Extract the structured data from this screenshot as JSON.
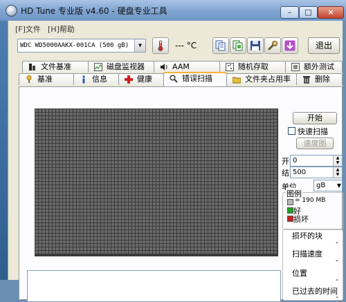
{
  "window": {
    "title": "HD Tune 专业版 v4.60 - 硬盘专业工具",
    "min_glyph": "–",
    "max_glyph": "□",
    "close_glyph": "×"
  },
  "menu": [
    {
      "label": "[F]文件"
    },
    {
      "label": "[H]帮助"
    }
  ],
  "toolbar": {
    "drive_value": "WDC    WD5000AAKX-001CA (500 gB)",
    "temperature": "--- °C",
    "exit_label": "退出"
  },
  "tabs_top": [
    {
      "label": "文件基准",
      "icon": "file-benchmark-icon"
    },
    {
      "label": "磁盘监视器",
      "icon": "disk-monitor-icon"
    },
    {
      "label": "AAM",
      "icon": "speaker-icon"
    },
    {
      "label": "随机存取",
      "icon": "random-access-icon"
    },
    {
      "label": "额外测试",
      "icon": "extra-tests-icon"
    }
  ],
  "tabs_bottom": [
    {
      "label": "基准",
      "icon": "benchmark-icon"
    },
    {
      "label": "信息",
      "icon": "info-icon"
    },
    {
      "label": "健康",
      "icon": "health-icon"
    },
    {
      "label": "错误扫描",
      "icon": "error-scan-icon",
      "active": true
    },
    {
      "label": "文件夹占用率",
      "icon": "folder-usage-icon"
    },
    {
      "label": "删除",
      "icon": "erase-icon"
    }
  ],
  "scan": {
    "start_button": "开始",
    "quick_scan_label": "快速扫描",
    "quick_scan_checked": false,
    "speed_map_button": "速度图",
    "start_label": "开始",
    "start_value": "0",
    "end_label": "结束",
    "end_value": "500",
    "unit_label": "单位",
    "unit_value": "gB"
  },
  "legend": {
    "title": "图例",
    "block_size": "= 190 MB",
    "good_label": "好",
    "damaged_label": "损坏",
    "block_color": "#b8b8b8",
    "good_color": "#1fa31f",
    "damaged_color": "#c81e1e"
  },
  "stats": {
    "damaged_blocks_label": "损坏的块",
    "damaged_blocks_value": "-",
    "scan_speed_label": "扫描速度",
    "scan_speed_value": "-",
    "position_label": "位置",
    "position_value": "-",
    "elapsed_label": "已过去的时间",
    "elapsed_value": "-"
  },
  "colors": {
    "grid_background": "#3a3a3a",
    "grid_block": "#6a6a6a",
    "active_tab_accent": "#f7b43c"
  }
}
